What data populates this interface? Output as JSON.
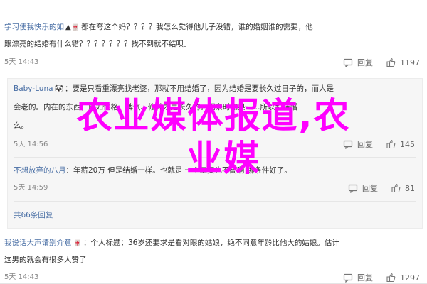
{
  "comments": [
    {
      "username": "学习使我快乐的如",
      "badge": "▲🀄",
      "text1": "都在夸这个妈？？？？我怎么觉得他儿子没错，谁的婚姻谁的需要，他",
      "text2": "跟漂亮的结婚有什么错？？？？？？？找不到就不结呗。",
      "time": "5天 14:43",
      "reply_label": "回复",
      "like_count": "1197"
    },
    {
      "username": "Baby-Luna",
      "badge": "🐼",
      "text1": "：要是只看重漂亮找老婆，那就不用结婚了，因为结婚是要长久过日子的，而人是",
      "text2": "会老的。内在的东西，比如性格、脾气、修养才是长久的。相亲时如果……所以别结婚",
      "text3": "么。",
      "time": "5天 14:56",
      "reply_label": "回复",
      "like_count": "145"
    },
    {
      "username": "不想放弃的八月",
      "badge": "",
      "text1": "：年薪20万 但是结婚一样。也就是 一个工资也不高啊 哪条件好了。",
      "time": "5天 14:59",
      "reply_label": "回复",
      "like_count": "81"
    },
    {
      "username": "我说话大声请别介意",
      "badge": "🀄",
      "text1": "：个人标题：36岁还要求是看对眼的姑娘，绝不同意年龄比他大的姑娘。估计",
      "text2": "这男的就会有很多人赞了",
      "time": "5天 14:43",
      "reply_label": "回复",
      "like_count": "1297"
    }
  ],
  "more_replies": "共66条回复",
  "overlay": {
    "line1": "农业媒体报道,农",
    "line2": "业媒"
  }
}
